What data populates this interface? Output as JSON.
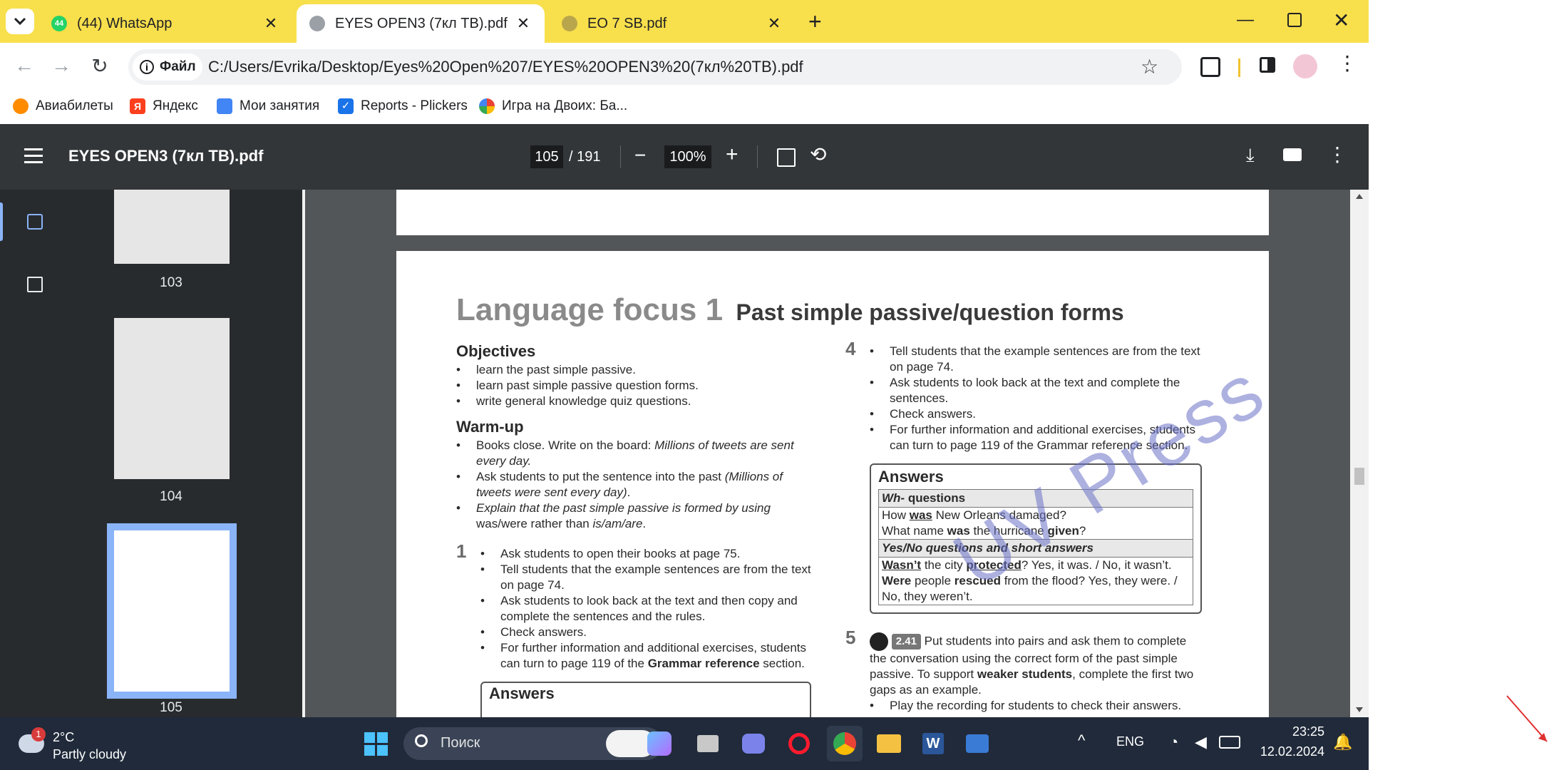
{
  "tabs": [
    {
      "title": "(44) WhatsApp",
      "badge": "44",
      "active": false
    },
    {
      "title": "EYES OPEN3 (7кл ТВ).pdf",
      "active": true
    },
    {
      "title": "EO 7 SB.pdf",
      "active": false
    }
  ],
  "toolbar": {
    "site_chip": "Файл",
    "url": "C:/Users/Evrika/Desktop/Eyes%20Open%207/EYES%20OPEN3%20(7кл%20ТВ).pdf"
  },
  "bookmarks": [
    {
      "label": "Авиабилеты"
    },
    {
      "label": "Яндекс"
    },
    {
      "label": "Мои занятия"
    },
    {
      "label": "Reports - Plickers"
    },
    {
      "label": "Игра на Двоих: Ба..."
    }
  ],
  "pdf": {
    "title": "EYES OPEN3 (7кл ТВ).pdf",
    "current_page": "105",
    "total_pages": "/ 191",
    "zoom": "100%"
  },
  "thumbnails": [
    {
      "label": "103"
    },
    {
      "label": "104"
    },
    {
      "label": "105"
    }
  ],
  "page_content": {
    "heading_main": "Language focus 1",
    "heading_sub": "Past simple passive/question forms",
    "objectives_title": "Objectives",
    "objectives": [
      "learn the past simple passive.",
      "learn past simple passive question forms.",
      "write general knowledge quiz questions."
    ],
    "warmup_title": "Warm-up",
    "warmup": {
      "b1_a": "Books close. Write on the board: ",
      "b1_b": "Millions of tweets are sent every day.",
      "b2_a": "Ask students to put the sentence into the past ",
      "b2_b": "(Millions of tweets were sent every day)",
      "b2_c": ".",
      "b3_a": "Explain that the past simple passive is formed by using ",
      "b3_b": "was/were",
      "b3_c": " rather than ",
      "b3_d": "is/am/are",
      "b3_e": "."
    },
    "ex1_num": "1",
    "ex1": {
      "b1": "Ask students to open their books at page 75.",
      "b2": "Tell students that the example sentences are from the text on page 74.",
      "b3": "Ask students to look back at the text and then copy and complete the sentences and the rules.",
      "b4": "Check answers.",
      "b5_a": "For further information and additional exercises, students can turn to page 119 of the ",
      "b5_b": "Grammar reference",
      "b5_c": " section."
    },
    "answers_bottom": "Answers",
    "ex4_num": "4",
    "ex4": {
      "b1": "Tell students that the example sentences are from the text on page 74.",
      "b2": "Ask students to look back at the text and complete the sentences.",
      "b3": "Check answers.",
      "b4": "For further information and additional exercises, students can turn to page 119 of the Grammar reference section."
    },
    "answers_box": {
      "title": "Answers",
      "wh_head_a": "Wh-",
      "wh_head_b": " questions",
      "wh1_a": "How ",
      "wh1_b": "was",
      "wh1_c": " New Orleans damaged?",
      "wh2_a": "What name ",
      "wh2_b": "was",
      "wh2_c": " the hurricane ",
      "wh2_d": "given",
      "wh2_e": "?",
      "yn_head": "Yes/No questions and short answers",
      "yn1_a": "Wasn’t",
      "yn1_b": " the city ",
      "yn1_c": "protected",
      "yn1_d": "? Yes, it was. / No, it wasn’t.",
      "yn2_a": "Were",
      "yn2_b": " people ",
      "yn2_c": "rescued",
      "yn2_d": " from the flood? Yes, they were. / No, they weren’t."
    },
    "ex5_num": "5",
    "ex5": {
      "track": "2.41",
      "t1": " Put students into pairs and ask them to complete the conversation using the correct form of the past simple passive. To support ",
      "t2": "weaker students",
      "t3": ", complete the first two gaps as an example.",
      "b_next": "Play the recording for students to check their answers."
    },
    "watermark": "UV Press"
  },
  "taskbar": {
    "weather_temp": "2°C",
    "weather_desc": "Partly cloudy",
    "weather_badge": "1",
    "search_placeholder": "Поиск",
    "lang": "ENG",
    "time": "23:25",
    "date": "12.02.2024"
  },
  "colors": {
    "tabstrip": "#f8df4c",
    "pdf_toolbar": "#323639",
    "pdf_sidebar": "#282b2e",
    "viewer_bg": "#525659",
    "taskbar": "#202a3a",
    "heading_grey": "#8a8a8a",
    "watermark": "#6b72c8"
  },
  "icons": [
    "chevron-down-icon",
    "whatsapp-icon",
    "pdf-globe-icon",
    "close-icon",
    "new-tab-icon",
    "minimize-icon",
    "restore-icon",
    "window-close-icon",
    "back-icon",
    "forward-icon",
    "reload-icon",
    "info-icon",
    "star-icon",
    "extensions-icon",
    "sidepanel-icon",
    "profile-avatar",
    "kebab-icon",
    "menu-icon",
    "zoom-out-icon",
    "zoom-in-icon",
    "fit-page-icon",
    "rotate-icon",
    "download-icon",
    "print-icon",
    "thumbnails-icon",
    "outline-icon",
    "speaker-icon",
    "windows-start-icon",
    "search-icon",
    "copilot-icon",
    "bell-icon"
  ]
}
